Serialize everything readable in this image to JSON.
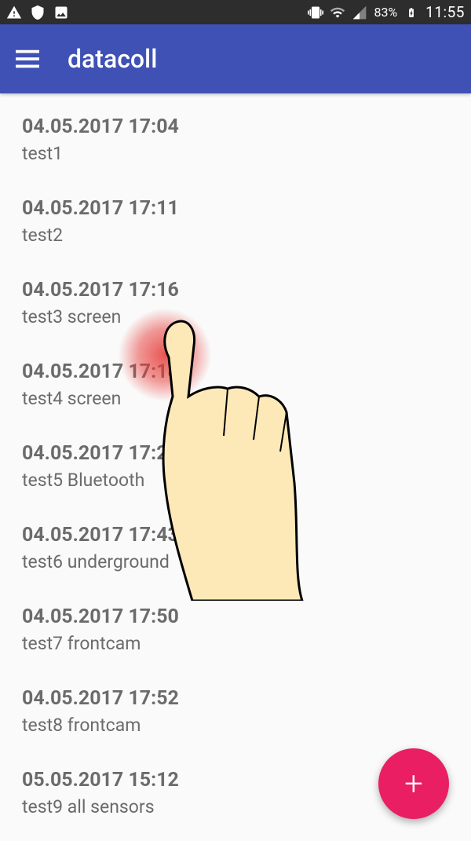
{
  "status": {
    "battery": "83%",
    "time": "11:55"
  },
  "app": {
    "title": "datacoll"
  },
  "list": {
    "items": [
      {
        "timestamp": "04.05.2017 17:04",
        "label": "test1"
      },
      {
        "timestamp": "04.05.2017 17:11",
        "label": "test2"
      },
      {
        "timestamp": "04.05.2017 17:16",
        "label": "test3 screen"
      },
      {
        "timestamp": "04.05.2017 17:18",
        "label": "test4 screen"
      },
      {
        "timestamp": "04.05.2017 17:21",
        "label": "test5 Bluetooth"
      },
      {
        "timestamp": "04.05.2017 17:43",
        "label": "test6 underground"
      },
      {
        "timestamp": "04.05.2017 17:50",
        "label": "test7 frontcam"
      },
      {
        "timestamp": "04.05.2017 17:52",
        "label": "test8 frontcam"
      },
      {
        "timestamp": "05.05.2017 15:12",
        "label": "test9 all sensors"
      }
    ]
  },
  "fab": {
    "label": "+"
  },
  "colors": {
    "primary": "#3f51b5",
    "accent": "#e91e63",
    "statusbar": "#2d2d2d"
  }
}
